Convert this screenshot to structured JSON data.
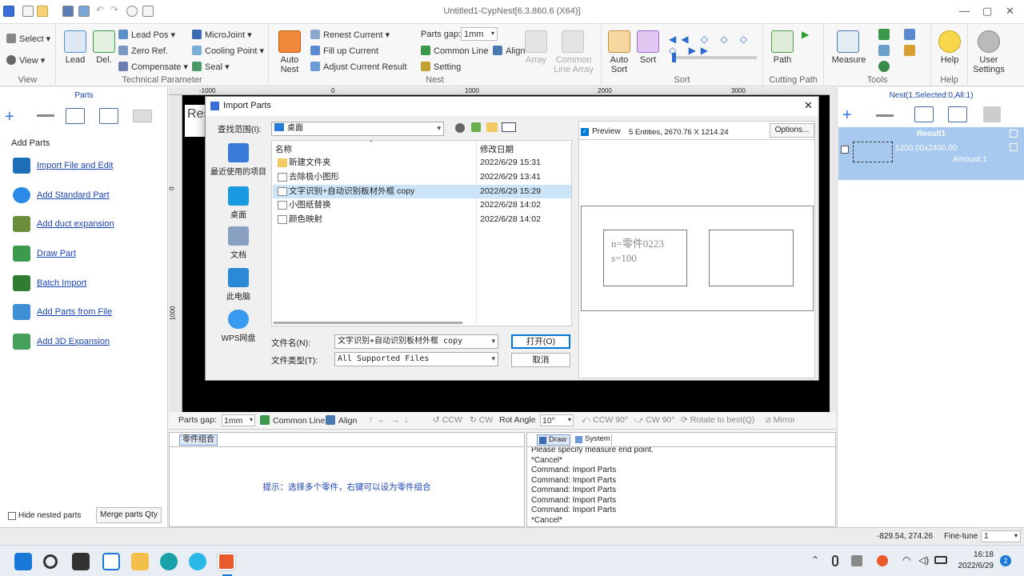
{
  "window": {
    "title": "Untitled1-CypNest[6.3.860.6 (X64)]"
  },
  "ribbon": {
    "view_group": {
      "name": "View",
      "select": "Select",
      "view": "View"
    },
    "tech_group": {
      "name": "Technical Parameter",
      "lead": "Lead",
      "del": "Del.",
      "lead_pos": "Lead Pos",
      "zero_ref": "Zero Ref.",
      "compensate": "Compensate",
      "microjoint": "MicroJoint",
      "cooling_point": "Cooling Point",
      "seal": "Seal"
    },
    "nest_group": {
      "name": "Nest",
      "auto_nest": "Auto Nest",
      "renest_current": "Renest Current",
      "fill_up_current": "Fill up Current",
      "adjust_current_result": "Adjust Current Result",
      "parts_gap_label": "Parts gap:",
      "parts_gap_value": "1mm",
      "common_line": "Common Line",
      "align": "Align",
      "setting": "Setting",
      "array": "Array",
      "common_line_array": "Common Line Array"
    },
    "sort_group": {
      "name": "Sort",
      "auto_sort": "Auto Sort",
      "sort": "Sort"
    },
    "cutting_group": {
      "name": "Cutting Path",
      "path": "Path"
    },
    "tools_group": {
      "name": "Tools",
      "measure": "Measure"
    },
    "help_group": {
      "name": "Help",
      "help": "Help"
    },
    "user_settings": "User Settings"
  },
  "left_panel": {
    "header": "Parts",
    "section_title": "Add Parts",
    "items": [
      {
        "label": "Import File and Edit",
        "color": "#1f6fb8"
      },
      {
        "label": "Add Standard Part",
        "color": "#2b8ae6"
      },
      {
        "label": "Add duct expansion",
        "color": "#6a8e3a"
      },
      {
        "label": "Draw Part",
        "color": "#3c9a4c"
      },
      {
        "label": "Batch Import",
        "color": "#2e7d32"
      },
      {
        "label": "Add Parts from File",
        "color": "#3f8fd6"
      },
      {
        "label": "Add 3D Expansion",
        "color": "#45a05a"
      }
    ],
    "hide_nested": "Hide nested parts",
    "merge_qty": "Merge parts Qty"
  },
  "canvas": {
    "ruler_top": [
      "-1000",
      "0",
      "1000",
      "2000",
      "3000"
    ],
    "ruler_left": [
      "0",
      "1000"
    ],
    "bg_label": "Res"
  },
  "dialog": {
    "title": "Import Parts",
    "lookin_label": "查找范围(I):",
    "lookin_value": "桌面",
    "nav": [
      "最近使用的项目",
      "桌面",
      "文档",
      "此电脑",
      "WPS网盘"
    ],
    "col_name": "名称",
    "col_date": "修改日期",
    "files": [
      {
        "name": "新建文件夹",
        "date": "2022/6/29 15:31",
        "type": "folder"
      },
      {
        "name": "去除极小图形",
        "date": "2022/6/29 13:41",
        "type": "file"
      },
      {
        "name": "文字识别+自动识别板材外框 copy",
        "date": "2022/6/29 15:29",
        "type": "file",
        "selected": true
      },
      {
        "name": "小图纸替换",
        "date": "2022/6/28 14:02",
        "type": "file"
      },
      {
        "name": "颜色映射",
        "date": "2022/6/28 14:02",
        "type": "file"
      }
    ],
    "filename_label": "文件名(N):",
    "filename_value": "文字识别+自动识别板材外框 copy",
    "filetype_label": "文件类型(T):",
    "filetype_value": "All Supported Files",
    "open_btn": "打开(O)",
    "cancel_btn": "取消",
    "preview_label": "Preview",
    "preview_info": "5 Entities, 2670.76 X 1214.24",
    "options_btn": "Options...",
    "preview_text1": "n=零件0223",
    "preview_text2": "s=100"
  },
  "bottom_bar": {
    "parts_gap_label": "Parts gap:",
    "parts_gap_value": "1mm",
    "common_line": "Common Line",
    "align": "Align",
    "ccw": "CCW",
    "cw": "CW",
    "rot_angle_label": "Rot Angle",
    "rot_angle_value": "10°",
    "ccw90": "CCW 90°",
    "cw90": "CW 90°",
    "rotate_best": "Rotate to best(Q)",
    "mirror": "Mirror"
  },
  "combo_pane": {
    "tab": "零件组合",
    "hint": "提示：选择多个零件，右键可以设为零件组合"
  },
  "cmd_pane": {
    "tab_draw": "Draw",
    "tab_system": "System",
    "lines": [
      "Please specify measure end point.",
      "*Cancel*",
      "Command: Import Parts",
      "Command: Import Parts",
      "Command: Import Parts",
      "Command: Import Parts",
      "Command: Import Parts",
      "*Cancel*"
    ]
  },
  "right_panel": {
    "header": "Nest(1,Selected:0,All:1)",
    "result_name": "Result1",
    "result_size": "1200.00x2400.00",
    "result_amount": "Amount:1"
  },
  "status": {
    "coords": "-829.54, 274.26",
    "fine_tune_label": "Fine-tune",
    "fine_tune_value": "1"
  },
  "taskbar": {
    "time": "16:18",
    "date": "2022/6/29",
    "notif": "2"
  }
}
